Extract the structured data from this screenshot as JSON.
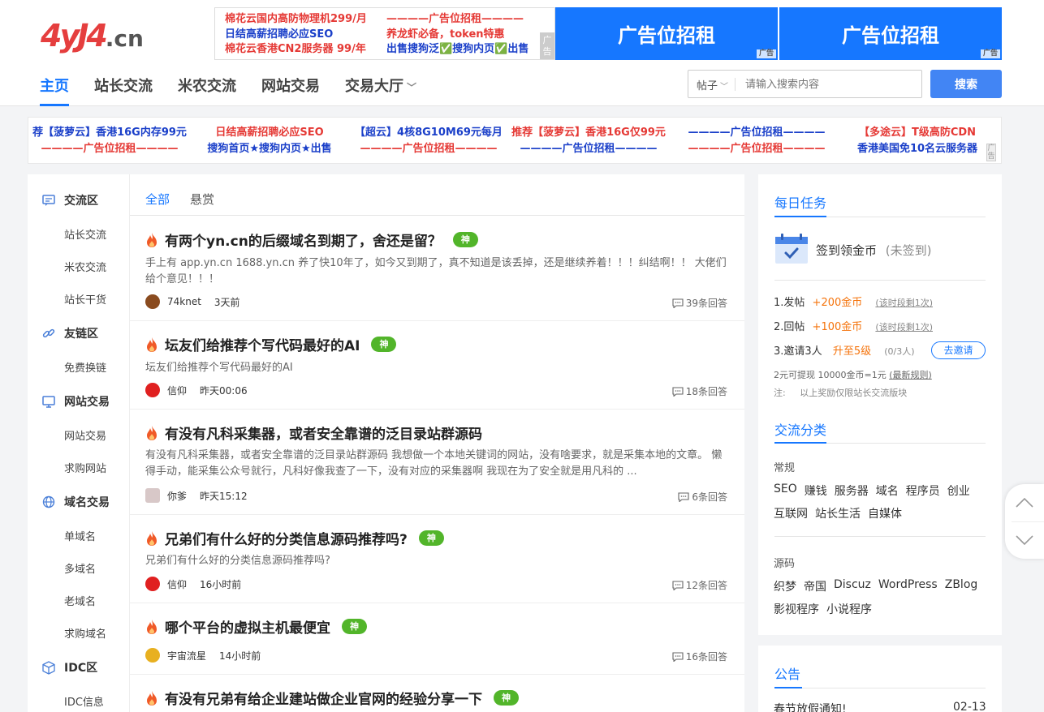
{
  "header": {
    "logo_brand": "4yJ4",
    "logo_tld": ".cn",
    "ad_box": {
      "left_lines": [
        "棉花云国内高防物理机299/月",
        "日结高薪招聘必应SEO",
        "棉花云香港CN2服务器 99/年"
      ],
      "right_lines": [
        "————广告位招租————",
        "养龙虾必备，token特惠",
        "出售搜狗泛✅搜狗内页✅出售"
      ],
      "tag": "广告"
    },
    "banners": [
      {
        "text": "广告位招租",
        "corner": "广告"
      },
      {
        "text": "广告位招租",
        "corner": "广告"
      }
    ],
    "nav": [
      {
        "label": "主页",
        "active": true
      },
      {
        "label": "站长交流",
        "active": false
      },
      {
        "label": "米农交流",
        "active": false
      },
      {
        "label": "网站交易",
        "active": false
      },
      {
        "label": "交易大厅",
        "active": false
      }
    ],
    "search": {
      "select_value": "帖子",
      "placeholder": "请输入搜索内容",
      "button": "搜索"
    }
  },
  "ad_strip": {
    "cells": [
      {
        "line1": "荐【菠萝云】香港16G内存99元",
        "line1_color": "blue",
        "line2": "————广告位招租————",
        "line2_color": "red"
      },
      {
        "line1": "日结高薪招聘必应SEO",
        "line1_color": "red",
        "line2": "搜狗首页★搜狗内页★出售",
        "line2_color": "blue"
      },
      {
        "line1": "【超云】4核8G10M69元每月",
        "line1_color": "blue",
        "line2": "————广告位招租————",
        "line2_color": "red"
      },
      {
        "line1": "推荐【菠萝云】香港16G仅99元",
        "line1_color": "red",
        "line2": "————广告位招租————",
        "line2_color": "blue"
      },
      {
        "line1": "————广告位招租————",
        "line1_color": "blue",
        "line2": "————广告位招租————",
        "line2_color": "red"
      },
      {
        "line1": "【多途云】T级高防CDN",
        "line1_color": "red",
        "line2": "香港美国免10名云服务器",
        "line2_color": "blue"
      }
    ],
    "tag": "广告"
  },
  "sidebar": {
    "sections": [
      {
        "title": "交流区",
        "icon": "chat-icon",
        "items": [
          "站长交流",
          "米农交流",
          "站长干货"
        ]
      },
      {
        "title": "友链区",
        "icon": "link-icon",
        "items": [
          "免费换链"
        ]
      },
      {
        "title": "网站交易",
        "icon": "monitor-icon",
        "items": [
          "网站交易",
          "求购网站"
        ]
      },
      {
        "title": "域名交易",
        "icon": "globe-icon",
        "items": [
          "单域名",
          "多域名",
          "老域名",
          "求购域名"
        ]
      },
      {
        "title": "IDC区",
        "icon": "cube-icon",
        "items": [
          "IDC信息"
        ]
      }
    ]
  },
  "main": {
    "tabs": [
      "全部",
      "悬赏"
    ],
    "posts": [
      {
        "title": "有两个yn.cn的后缀域名到期了，舍还是留？",
        "badge": "神",
        "excerpt": "手上有 app.yn.cn 1688.yn.cn 养了快10年了，如今又到期了，真不知道是该丢掉，还是继续养着！！！纠结啊！！ 大佬们给个意见！！！",
        "author": "74knet",
        "time": "3天前",
        "replies": "39条回答",
        "avatar_color": "#8a4b1f"
      },
      {
        "title": "坛友们给推荐个写代码最好的AI",
        "badge": "神",
        "excerpt": "坛友们给推荐个写代码最好的AI",
        "author": "信仰",
        "time": "昨天00:06",
        "replies": "18条回答",
        "avatar_color": "#e02020"
      },
      {
        "title": "有没有凡科采集器，或者安全靠谱的泛目录站群源码",
        "badge": "",
        "excerpt": "有没有凡科采集器，或者安全靠谱的泛目录站群源码 我想做一个本地关键词的网站，没有啥要求，就是采集本地的文章。 懒得手动，能采集公众号就行，凡科好像我查了一下，没有对应的采集器啊 我现在为了安全就是用凡科的 ...",
        "author": "你爹",
        "time": "昨天15:12",
        "replies": "6条回答",
        "avatar_color": "#d8c8c8"
      },
      {
        "title": "兄弟们有什么好的分类信息源码推荐吗?",
        "badge": "神",
        "excerpt": "兄弟们有什么好的分类信息源码推荐吗?",
        "author": "信仰",
        "time": "16小时前",
        "replies": "12条回答",
        "avatar_color": "#e02020"
      },
      {
        "title": "哪个平台的虚拟主机最便宜",
        "badge": "神",
        "excerpt": "",
        "author": "宇宙流星",
        "time": "14小时前",
        "replies": "16条回答",
        "avatar_color": "#e8b020"
      },
      {
        "title": "有没有兄弟有给企业建站做企业官网的经验分享一下",
        "badge": "神",
        "excerpt": "",
        "author": "",
        "time": "",
        "replies": "",
        "avatar_color": ""
      }
    ]
  },
  "daily": {
    "title": "每日任务",
    "signin": "签到领金币",
    "signin_status": "(未签到)",
    "tasks": [
      {
        "label": "1.发帖",
        "reward": "+200金币",
        "note": "(该时段剩1次)"
      },
      {
        "label": "2.回帖",
        "reward": "+100金币",
        "note": "(该时段剩1次)"
      },
      {
        "label": "3.邀请3人",
        "reward": "升至5级",
        "note": "(0/3人)"
      }
    ],
    "invite_button": "去邀请",
    "cashout": "2元可提现 10000金币=1元",
    "cashout_link": "(最新规则)",
    "note_label": "注:",
    "note_text": "以上奖励仅限站长交流版块"
  },
  "topics": {
    "title": "交流分类",
    "groups": [
      {
        "name": "常规",
        "rows": [
          [
            "SEO",
            "赚钱",
            "服务器",
            "域名",
            "程序员",
            "创业"
          ],
          [
            "互联网",
            "站长生活",
            "自媒体"
          ]
        ]
      },
      {
        "name": "源码",
        "rows": [
          [
            "织梦",
            "帝国",
            "Discuz",
            "WordPress",
            "ZBlog"
          ],
          [
            "影视程序",
            "小说程序"
          ]
        ]
      }
    ]
  },
  "notice": {
    "title": "公告",
    "items": [
      {
        "text": "春节放假通知!",
        "date": "02-13"
      }
    ]
  },
  "colors": {
    "accent": "#1677ff",
    "badge": "#52b52a",
    "ad_red": "#e53935",
    "ad_blue": "#1a3fc9",
    "orange": "#f5730b"
  }
}
